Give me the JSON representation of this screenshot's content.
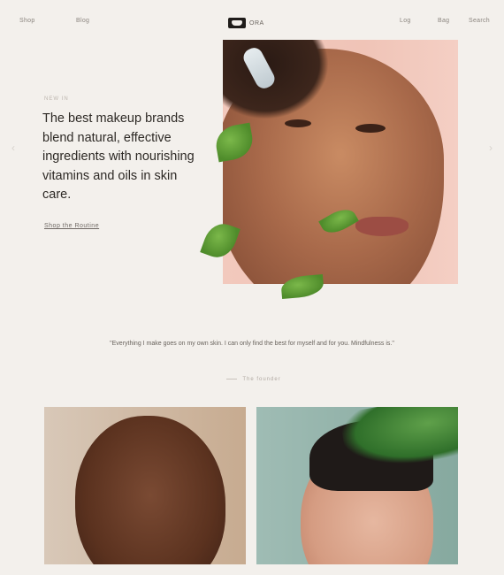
{
  "nav": {
    "left_links": [
      "Shop",
      "Blog"
    ],
    "right_links": [
      "Log",
      "Bag",
      "Search"
    ],
    "brand_word": "ORA"
  },
  "hero": {
    "eyebrow": "New in",
    "headline": "The best makeup brands blend natural, effective ingredients with nourishing vitamins and oils in skin care.",
    "cta": "Shop the Routine"
  },
  "quote": {
    "text": "\"Everything I make goes on my own skin. I can only find the best for myself and for you. Mindfulness is.\"",
    "by": "The founder"
  },
  "icons": {
    "prev": "chevron-left-icon",
    "next": "chevron-right-icon"
  },
  "colors": {
    "background": "#f3f0ec",
    "hero_backdrop": "#f0c4b7",
    "leaf_green": "#4f8c2b",
    "right_photo_backdrop": "#86a99f"
  }
}
